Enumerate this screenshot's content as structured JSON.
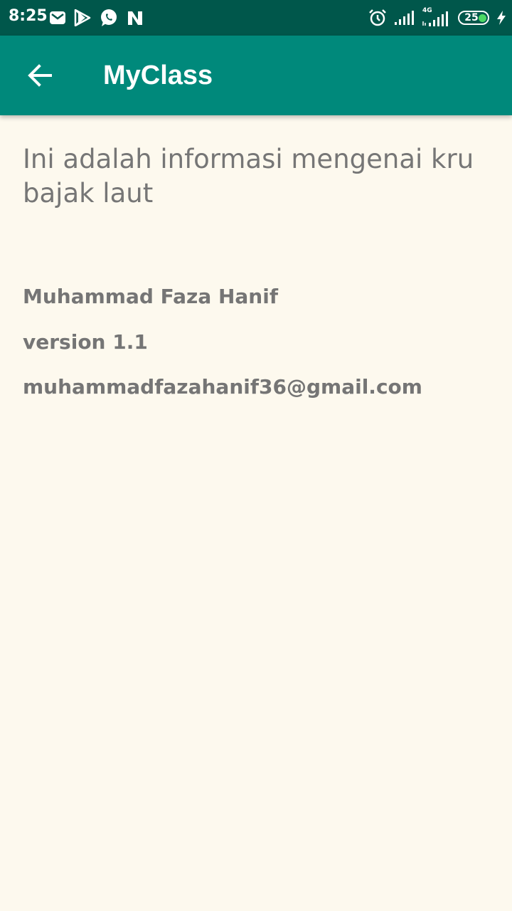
{
  "status_bar": {
    "time": "8:25",
    "battery_level": "25",
    "network_type": "4G",
    "left_icons": [
      "gmail-icon",
      "play-store-icon",
      "whatsapp-icon",
      "n-app-icon"
    ],
    "right_icons": [
      "alarm-icon",
      "signal-icon",
      "signal-4g-icon",
      "battery-icon",
      "charging-icon"
    ]
  },
  "app_bar": {
    "title": "MyClass",
    "background": "#00897b"
  },
  "content": {
    "intro": "Ini adalah informasi mengenai kru bajak laut",
    "author": "Muhammad Faza Hanif",
    "version": "version 1.1",
    "email": "muhammadfazahanif36@gmail.com"
  },
  "colors": {
    "status_bar": "#00574b",
    "app_bar": "#00897b",
    "page_background": "#fdf9ee",
    "text": "#767676"
  }
}
